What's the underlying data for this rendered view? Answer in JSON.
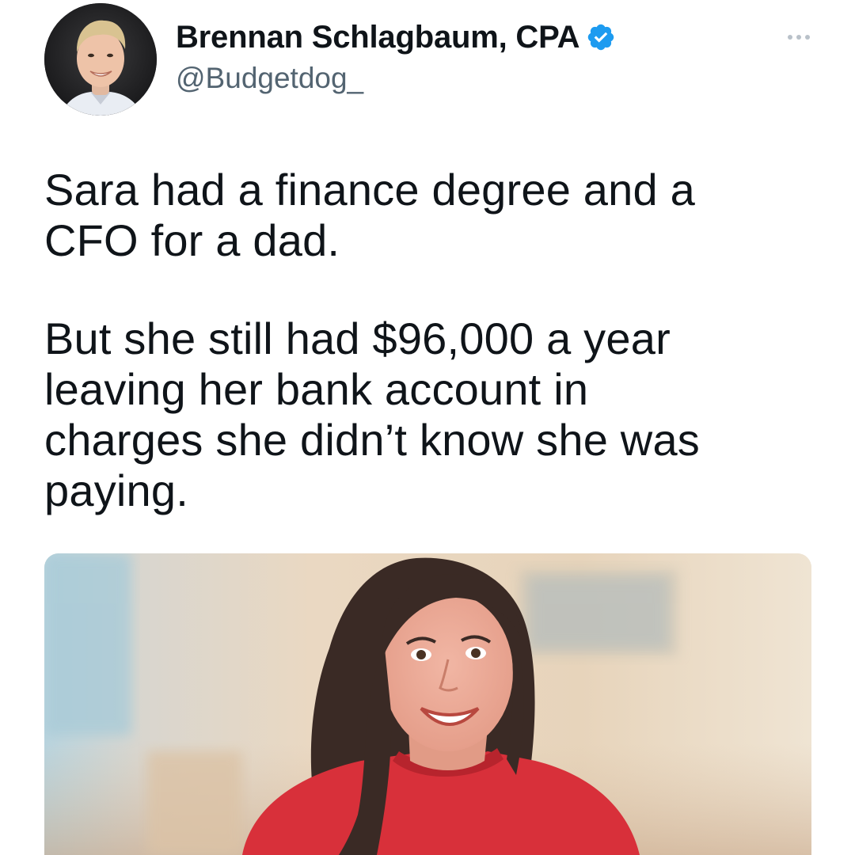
{
  "author": {
    "display_name": "Brennan Schlagbaum, CPA",
    "handle": "@Budgetdog_",
    "verified": true,
    "avatar": "avatar-photo"
  },
  "actions": {
    "more_icon": "more-horizontal-icon"
  },
  "tweet": {
    "paragraphs": [
      "Sara had a finance degree and a\nCFO for a dad.",
      "But she still had $96,000 a year\nleaving her bank account in\ncharges she didn’t know she was\npaying."
    ]
  },
  "media": {
    "type": "photo",
    "alt": "woman-in-red-sweater-photo"
  },
  "colors": {
    "text": "#0f1419",
    "secondary_text": "#536471",
    "verified_badge": "#1d9bf0",
    "sweater": "#d8303a"
  }
}
